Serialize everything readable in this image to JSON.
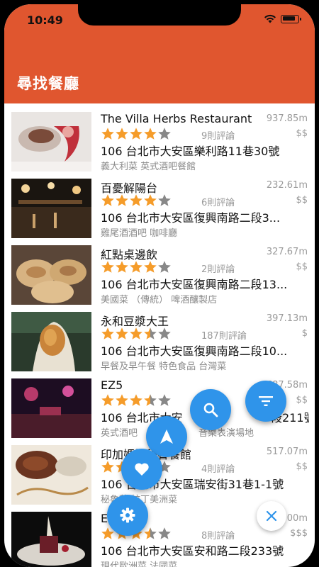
{
  "status_bar": {
    "time": "10:49"
  },
  "header": {
    "title": "尋找餐廳"
  },
  "restaurants": [
    {
      "name": "The Villa Herbs Restaurant",
      "distance": "937.85m",
      "rating": 4,
      "reviews": "9則評論",
      "price": "$$",
      "address": "106 台北市大安區樂利路11巷30號",
      "categories": "義大利菜 英式酒吧餐館"
    },
    {
      "name": "百憂解陽台",
      "distance": "232.61m",
      "rating": 4,
      "reviews": "6則評論",
      "price": "$$",
      "address": "106 台北市大安區復興南路二段3...",
      "categories": "雞尾酒酒吧 咖啡廳"
    },
    {
      "name": "紅點桌邊飲",
      "distance": "327.67m",
      "rating": 4,
      "reviews": "2則評論",
      "price": "$$",
      "address": "106 台北市大安區復興南路二段13...",
      "categories": "美國菜 （傳統） 啤酒釀製店"
    },
    {
      "name": "永和豆漿大王",
      "distance": "397.13m",
      "rating": 3.5,
      "reviews": "187則評論",
      "price": "$",
      "address": "106 台北市大安區復興南路二段10...",
      "categories": "早餐及早午餐 特色食品 台灣菜"
    },
    {
      "name": "EZ5",
      "distance": "687.58m",
      "rating": 3.5,
      "reviews": "",
      "price": "$$",
      "address": "106 台北市大安",
      "address_tail": "段211號",
      "categories": "英式酒吧",
      "categories_tail": "音樂表演場地"
    },
    {
      "name": "印加媽媽秘魯餐館",
      "distance": "517.07m",
      "rating": 4,
      "reviews": "4則評論",
      "price": "$$",
      "address": "106 台北市大安區瑞安街31巷1-1號",
      "categories": "秘魯菜 拉丁美洲菜"
    },
    {
      "name": "E",
      "name_tail": "té",
      "distance": "",
      "distance_tail": "00m",
      "rating": 3.5,
      "reviews": "8則評論",
      "price": "$$$",
      "address": "106 台北市大安區安和路二段233號",
      "categories": "現代歐洲菜 法國菜"
    }
  ],
  "colors": {
    "header": "#e0562f",
    "fab": "#2f94ea",
    "star": "#f59c2a",
    "star_empty": "#888888",
    "close_x": "#2f94ea"
  },
  "fab_icons": [
    "filter-icon",
    "search-icon",
    "navigation-icon",
    "heart-icon",
    "gear-icon",
    "close-icon"
  ]
}
